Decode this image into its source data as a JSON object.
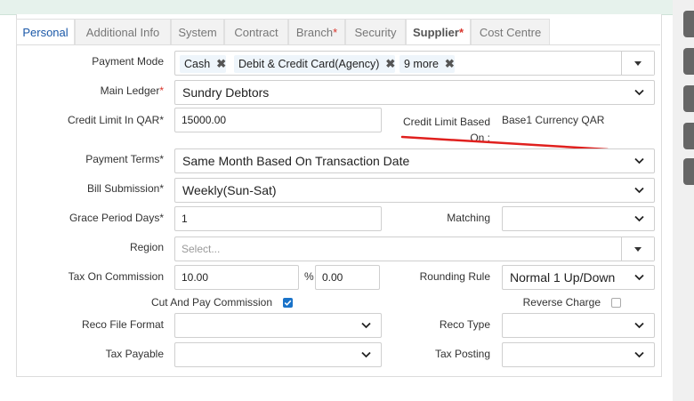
{
  "tabs": [
    {
      "label": "Personal"
    },
    {
      "label": "Additional Info"
    },
    {
      "label": "System"
    },
    {
      "label": "Contract"
    },
    {
      "label": "Branch",
      "required": "*"
    },
    {
      "label": "Security"
    },
    {
      "label": "Supplier",
      "required": "*"
    },
    {
      "label": "Cost Centre"
    }
  ],
  "form": {
    "payment_mode": {
      "label": "Payment Mode",
      "chips": [
        "Cash",
        "Debit & Credit Card(Agency)",
        "9 more"
      ],
      "remove_glyph": "✖"
    },
    "main_ledger": {
      "label": "Main Ledger",
      "required": "*",
      "value": "Sundry Debtors"
    },
    "credit_limit": {
      "label": "Credit Limit In QAR*",
      "value": "15000.00"
    },
    "credit_limit_based": {
      "label_line1": "Credit Limit Based",
      "label_line2": "On :",
      "value": "Base1 Currency QAR"
    },
    "payment_terms": {
      "label": "Payment Terms*",
      "value": "Same Month Based On Transaction Date"
    },
    "bill_submission": {
      "label": "Bill Submission*",
      "value": "Weekly(Sun-Sat)"
    },
    "grace_period": {
      "label": "Grace Period Days*",
      "value": "1"
    },
    "matching": {
      "label": "Matching",
      "value": ""
    },
    "region": {
      "label": "Region",
      "placeholder": "Select..."
    },
    "tax_on_commission": {
      "label": "Tax On Commission",
      "value": "10.00",
      "percent_sign": "%",
      "percent_value": "0.00"
    },
    "rounding_rule": {
      "label": "Rounding Rule",
      "value": "Normal 1 Up/Down"
    },
    "cut_and_pay": {
      "label": "Cut And Pay Commission",
      "checked": true
    },
    "reverse_charge": {
      "label": "Reverse Charge",
      "checked": false
    },
    "reco_file_format": {
      "label": "Reco File Format",
      "value": ""
    },
    "reco_type": {
      "label": "Reco Type",
      "value": ""
    },
    "tax_payable": {
      "label": "Tax Payable",
      "value": ""
    },
    "tax_posting": {
      "label": "Tax Posting",
      "value": ""
    }
  },
  "colors": {
    "accent": "#1a58a8",
    "required": "#d9342b",
    "annotation": "#e0201e",
    "checkbox": "#1a73c9"
  }
}
